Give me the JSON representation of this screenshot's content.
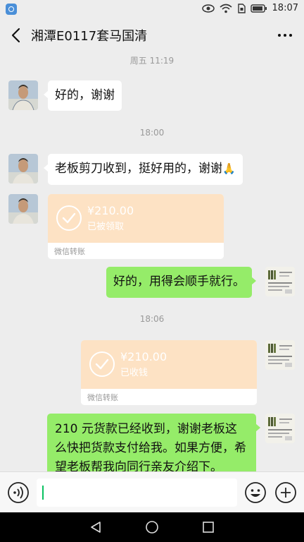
{
  "status_bar": {
    "time": "18:07"
  },
  "header": {
    "title": "湘潭E0117套马国清"
  },
  "messages": {
    "ts1": "周五 11:19",
    "m1": "好的，谢谢",
    "ts2": "18:00",
    "m2": "老板剪刀收到，挺好用的，谢谢",
    "m2_emoji": "🙏",
    "t1_amount": "¥210.00",
    "t1_status": "已被领取",
    "t1_label": "微信转账",
    "m3": "好的，用得会顺手就行。",
    "ts3": "18:06",
    "t2_amount": "¥210.00",
    "t2_status": "已收钱",
    "t2_label": "微信转账",
    "m4": "210 元货款已经收到，谢谢老板这么快把货款支付给我。如果方便，希望老板帮我向同行亲友介绍下。"
  },
  "colors": {
    "outgoing": "#95ec69",
    "transfer": "#fde2c4",
    "background": "#ededed"
  }
}
